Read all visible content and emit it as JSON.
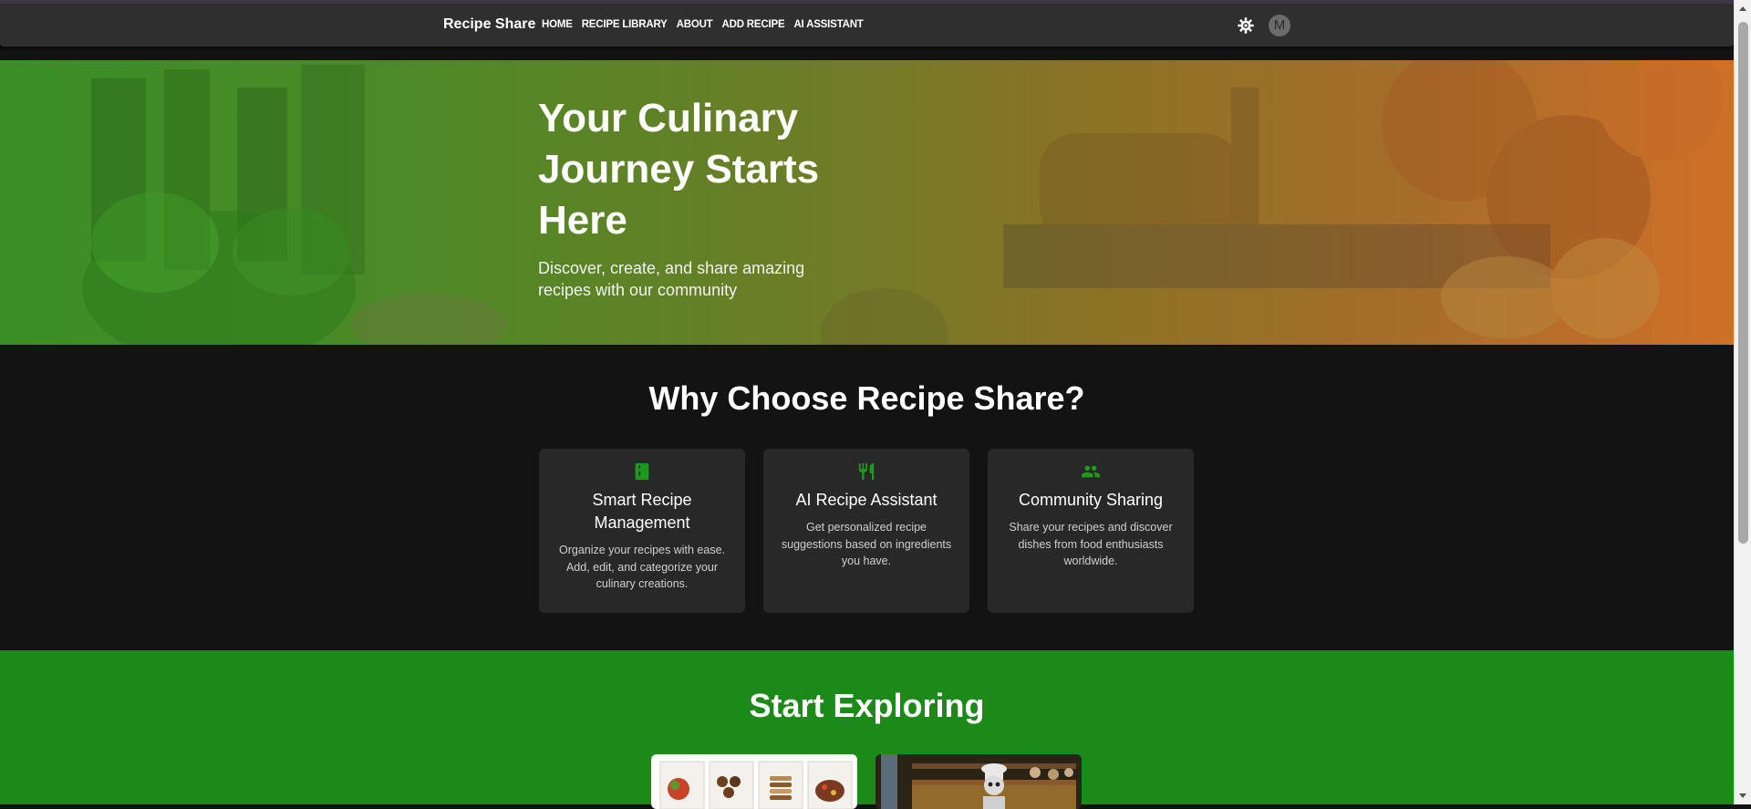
{
  "navbar": {
    "brand": "Recipe Share",
    "links": [
      "HOME",
      "RECIPE LIBRARY",
      "ABOUT",
      "ADD RECIPE",
      "AI ASSISTANT"
    ],
    "theme_icon": "gear-icon",
    "avatar_initial": "M"
  },
  "hero": {
    "title": "Your Culinary Journey Starts Here",
    "subtitle": "Discover, create, and share amazing recipes with our community"
  },
  "why": {
    "title": "Why Choose Recipe Share?",
    "cards": [
      {
        "icon": "kitchen-icon",
        "title": "Smart Recipe Management",
        "text": "Organize your recipes with ease. Add, edit, and categorize your culinary creations."
      },
      {
        "icon": "restaurant-icon",
        "title": "AI Recipe Assistant",
        "text": "Get personalized recipe suggestions based on ingredients you have."
      },
      {
        "icon": "people-icon",
        "title": "Community Sharing",
        "text": "Share your recipes and discover dishes from food enthusiasts worldwide."
      }
    ]
  },
  "explore": {
    "title": "Start Exploring"
  },
  "colors": {
    "accent_green": "#1c8a18",
    "icon_green": "#1f9a1c",
    "navbar_bg": "#2f2f2f",
    "section_bg": "#131313",
    "card_bg": "#282828"
  }
}
